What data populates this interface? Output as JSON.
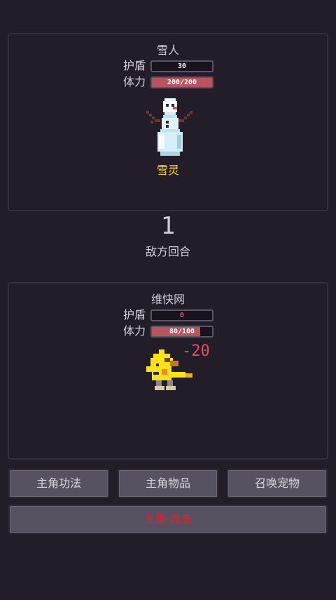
{
  "enemy": {
    "name": "雪人",
    "shield_label": "护盾",
    "shield_value": "30",
    "hp_label": "体力",
    "hp_text": "200/200",
    "hp_fraction": 1.0,
    "species": "雪灵",
    "sprite_icon": "snowman-icon"
  },
  "turn": {
    "number": "1",
    "label": "敌方回合"
  },
  "player": {
    "name": "维快网",
    "shield_label": "护盾",
    "shield_value": "0",
    "hp_label": "体力",
    "hp_text": "80/100",
    "hp_fraction": 0.8,
    "damage_popup": "-20",
    "sprite_icon": "duck-hero-icon"
  },
  "actions": {
    "skills_label": "主角功法",
    "items_label": "主角物品",
    "summon_label": "召唤宠物",
    "attack_label": "主角-攻击"
  },
  "colors": {
    "background": "#221d29",
    "hp_bar": "#b8545e",
    "species_text": "#ffce42",
    "attack_text": "#e0202a",
    "damage_text": "#e0505e"
  }
}
